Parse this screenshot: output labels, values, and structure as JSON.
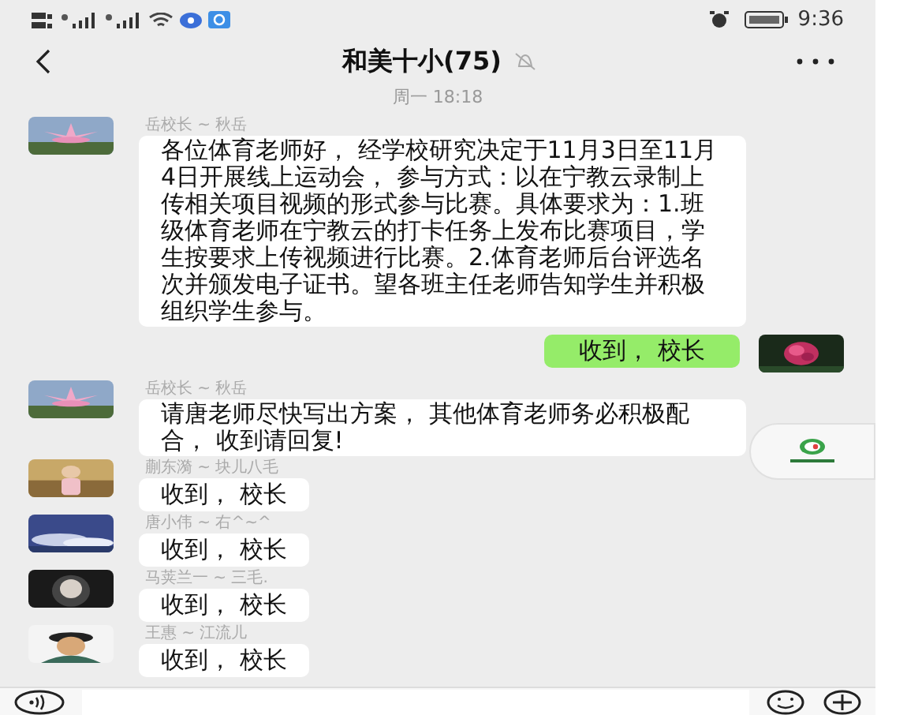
{
  "status_bar": {
    "time": "9:36"
  },
  "header": {
    "title": "和美十小(75)",
    "muted": true
  },
  "timestamp": "周一 18:18",
  "messages": [
    {
      "kind": "incoming",
      "sender": "岳校长 ~ 秋岳",
      "text": "各位体育老师好， 经学校研究决定于11月3日至11月4日开展线上运动会， 参与方式：以在宁教云录制上传相关项目视频的形式参与比赛。具体要求为：1.班级体育老师在宁教云的打卡任务上发布比赛项目，学生按要求上传视频进行比赛。2.体育老师后台评选名次并颁发电子证书。望各班主任老师告知学生并积极组织学生参与。"
    },
    {
      "kind": "outgoing",
      "text": "收到， 校长"
    },
    {
      "kind": "incoming",
      "sender": "岳校长 ~ 秋岳",
      "text": "请唐老师尽快写出方案， 其他体育老师务必积极配合， 收到请回复!"
    },
    {
      "kind": "incoming",
      "sender": "蒯东漪 ~ 块儿八毛",
      "text": "收到， 校长"
    },
    {
      "kind": "incoming",
      "sender": "唐小伟 ~ 右^~^",
      "text": "收到， 校长"
    },
    {
      "kind": "incoming",
      "sender": "马荚兰一 ~ 三毛.",
      "text": "收到， 校长"
    },
    {
      "kind": "incoming",
      "sender": "王惠 ~ 江流儿",
      "text": "收到， 校长"
    }
  ]
}
